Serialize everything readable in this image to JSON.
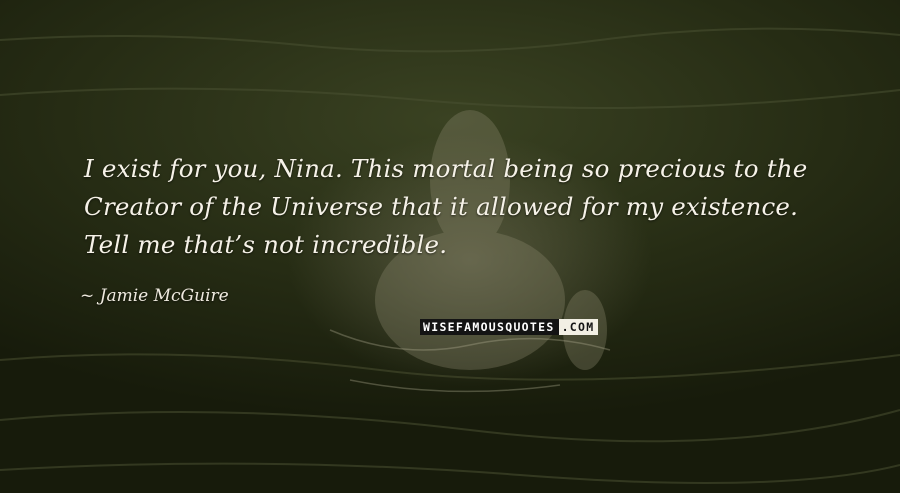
{
  "quote": {
    "lines": [
      "I exist for you, Nina. This mortal being so precious to the",
      "Creator of the Universe that it allowed for my existence.",
      "Tell me that’s not incredible."
    ]
  },
  "author": {
    "name": "Jamie McGuire"
  },
  "watermark": {
    "brand": "WISEFAMOUSQUOTES",
    "suffix": ".COM"
  },
  "colors": {
    "background": "#1c2210",
    "text": "#f6f2e8"
  }
}
